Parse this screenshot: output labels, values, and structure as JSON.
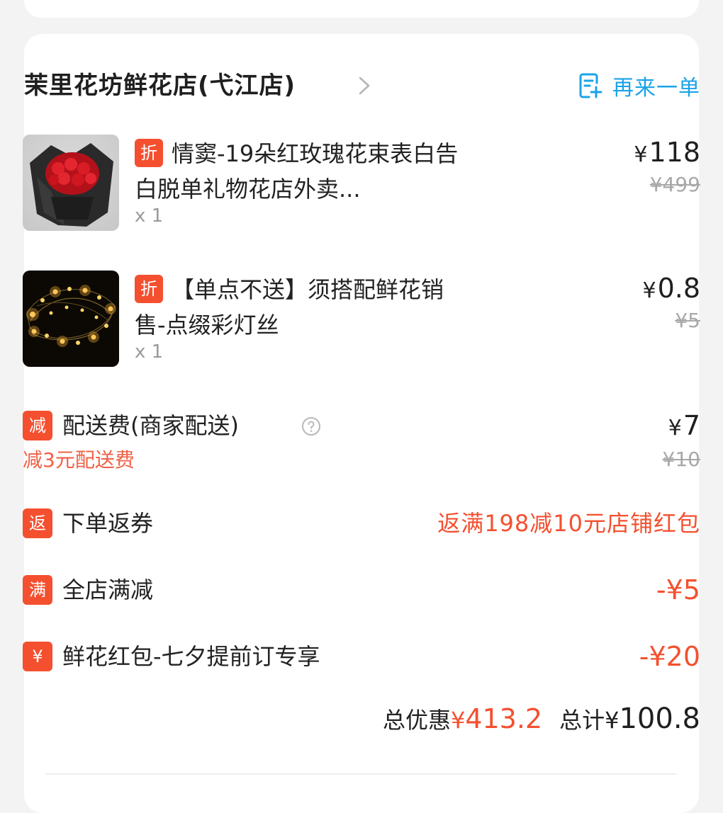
{
  "shop": {
    "name": "茉里花坊鲜花店(弋江店)",
    "reorder_label": "再来一单"
  },
  "items": [
    {
      "tag": "折",
      "title": "情窦-19朵红玫瑰花束表白告白脱单礼物花店外卖...",
      "quantity": "x 1",
      "price_symbol": "¥",
      "price": "118",
      "original_price": "¥499",
      "image": "red-rose-bouquet"
    },
    {
      "tag": "折",
      "title": "【单点不送】须搭配鲜花销售-点缀彩灯丝",
      "quantity": "x 1",
      "price_symbol": "¥",
      "price": "0.8",
      "original_price": "¥5",
      "image": "fairy-string-lights"
    }
  ],
  "delivery": {
    "tag": "减",
    "label": "配送费(商家配送)",
    "price_symbol": "¥",
    "price": "7",
    "original_price": "¥10",
    "discount_note": "减3元配送费"
  },
  "rebate": {
    "tag": "返",
    "label": "下单返券",
    "value": "返满198减10元店铺红包"
  },
  "store_discount": {
    "tag": "满",
    "label": "全店满减",
    "value": "-¥5"
  },
  "red_packet": {
    "tag": "¥",
    "label": "鲜花红包-七夕提前订专享",
    "value": "-¥20"
  },
  "summary": {
    "discount_label": "总优惠",
    "discount_symbol": "¥",
    "discount_value": "413.2",
    "total_label": "总计",
    "total_symbol": "¥",
    "total_value": "100.8"
  },
  "colors": {
    "accent_red": "#f4502f",
    "link_blue": "#1aa3e8"
  }
}
